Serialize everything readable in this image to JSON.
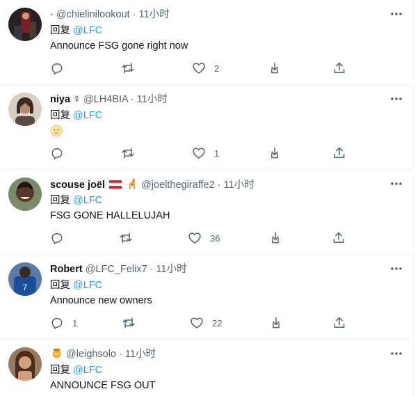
{
  "reply_prefix": "回复",
  "tweets": [
    {
      "name": "",
      "handle": "- @chielinilookout",
      "dot": "·",
      "time": "11小时",
      "mention": "@LFC",
      "text": "Announce FSG gone right now",
      "counts": {
        "reply": "",
        "retweet": "",
        "like": "2"
      },
      "avatar_icon": "avatar-photo-icon",
      "extra_icons": []
    },
    {
      "name": "niya",
      "name_symbol": "☿",
      "handle": "@LH4BIA",
      "dot": "·",
      "time": "11小时",
      "mention": "@LFC",
      "text": "",
      "text_emoji": "face-emoji-icon",
      "counts": {
        "reply": "",
        "retweet": "",
        "like": "1"
      },
      "avatar_icon": "avatar-photo-icon"
    },
    {
      "name": "scouse joël",
      "handle": "@joelthegiraffe2",
      "dot": "·",
      "time": "11小时",
      "mention": "@LFC",
      "text": "FSG GONE HALLELUJAH",
      "counts": {
        "reply": "",
        "retweet": "",
        "like": "36"
      },
      "avatar_icon": "avatar-photo-icon",
      "extra_icons": [
        "austria-flag-icon",
        "giraffe-emoji-icon"
      ]
    },
    {
      "name": "Robert",
      "handle": "@LFC_Felix7",
      "dot": "·",
      "time": "11小时",
      "mention": "@LFC",
      "text": "Announce new owners",
      "counts": {
        "reply": "1",
        "retweet": "",
        "like": "22"
      },
      "avatar_icon": "avatar-photo-icon"
    },
    {
      "name": "",
      "handle": "@leighsolo",
      "dot": "·",
      "time": "11小时",
      "mention": "@LFC",
      "text": "ANNOUNCE FSG OUT",
      "counts": {
        "reply": "",
        "retweet": "",
        "like": ""
      },
      "avatar_icon": "avatar-photo-icon",
      "extra_icons": [
        "honey-pot-emoji-icon"
      ]
    }
  ],
  "colors": {
    "accent": "#1d9bf0",
    "muted": "#536471",
    "text": "#0f1419",
    "divider": "#eff3f4"
  }
}
